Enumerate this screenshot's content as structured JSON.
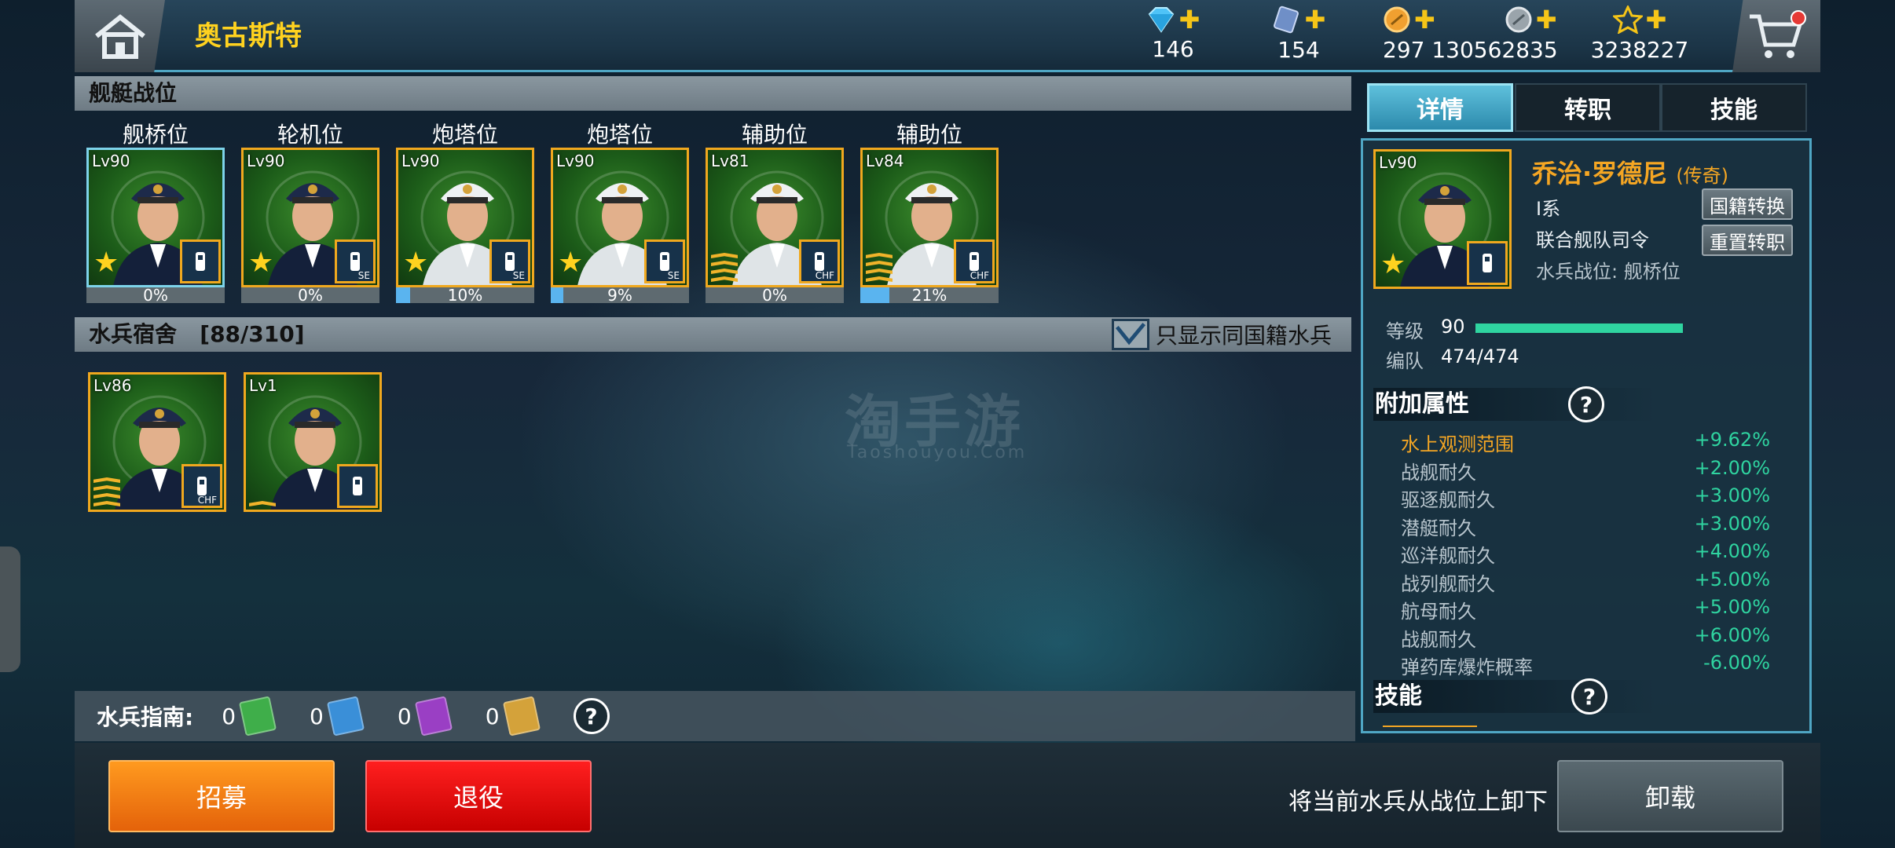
{
  "header": {
    "title": "奥古斯特",
    "resources": [
      {
        "icon": "diamond-icon",
        "value": "146"
      },
      {
        "icon": "blueprint-icon",
        "value": "154"
      },
      {
        "icon": "gold-coin-icon",
        "value": "297"
      },
      {
        "icon": "silver-coin-icon",
        "value": "130562835"
      },
      {
        "icon": "star-icon",
        "value": "3238227"
      }
    ]
  },
  "ship_positions": {
    "header": "舰艇战位",
    "slots": [
      {
        "label": "舰桥位",
        "level": "Lv90",
        "progress": 0,
        "progress_text": "0%",
        "rank": "star",
        "badge": "radio-icon",
        "badge_text": ""
      },
      {
        "label": "轮机位",
        "level": "Lv90",
        "progress": 0,
        "progress_text": "0%",
        "rank": "star",
        "badge": "engine-icon",
        "badge_text": "SE"
      },
      {
        "label": "炮塔位",
        "level": "Lv90",
        "progress": 10,
        "progress_text": "10%",
        "rank": "star",
        "badge": "hand-icon",
        "badge_text": "SE"
      },
      {
        "label": "炮塔位",
        "level": "Lv90",
        "progress": 9,
        "progress_text": "9%",
        "rank": "star",
        "badge": "hand-icon",
        "badge_text": "SE"
      },
      {
        "label": "辅助位",
        "level": "Lv81",
        "progress": 0,
        "progress_text": "0%",
        "rank": "chevrons",
        "badge": "radar-dish-icon",
        "badge_text": "CHF"
      },
      {
        "label": "辅助位",
        "level": "Lv84",
        "progress": 21,
        "progress_text": "21%",
        "rank": "chevrons",
        "badge": "radar-dish-icon",
        "badge_text": "CHF"
      }
    ]
  },
  "dormitory": {
    "header": "水兵宿舍",
    "count": "[88/310]",
    "filter_label": "只显示同国籍水兵",
    "sailors": [
      {
        "level": "Lv86",
        "rank": "chevrons",
        "badge": "radar-dish-icon",
        "badge_text": "CHF"
      },
      {
        "level": "Lv1",
        "rank": "single-chevron",
        "badge": "glove-icon",
        "badge_text": ""
      }
    ]
  },
  "guide": {
    "label": "水兵指南:",
    "items": [
      {
        "count": "0",
        "color": "#3fae4a"
      },
      {
        "count": "0",
        "color": "#3a8fd8"
      },
      {
        "count": "0",
        "color": "#9a3fc4"
      },
      {
        "count": "0",
        "color": "#d4a23a"
      }
    ],
    "help": "?"
  },
  "buttons": {
    "recruit": "招募",
    "retire": "退役",
    "unload_hint": "将当前水兵从战位上卸下",
    "unload": "卸载"
  },
  "tabs": [
    "详情",
    "转职",
    "技能"
  ],
  "detail": {
    "level": "Lv90",
    "name": "乔治·罗德尼",
    "rarity": "(传奇)",
    "nation": "I系",
    "role": "联合舰队司令",
    "position": "水兵战位: 舰桥位",
    "btn_nation": "国籍转换",
    "btn_reset": "重置转职",
    "level_label": "等级",
    "level_value": "90",
    "level_fill": 1.0,
    "team_label": "编队",
    "team_value": "474/474",
    "attr_header": "附加属性",
    "attributes": [
      {
        "name": "水上观测范围",
        "value": "+9.62%"
      },
      {
        "name": "战舰耐久",
        "value": "+2.00%"
      },
      {
        "name": "驱逐舰耐久",
        "value": "+3.00%"
      },
      {
        "name": "潜艇耐久",
        "value": "+3.00%"
      },
      {
        "name": "巡洋舰耐久",
        "value": "+4.00%"
      },
      {
        "name": "战列舰耐久",
        "value": "+5.00%"
      },
      {
        "name": "航母耐久",
        "value": "+5.00%"
      },
      {
        "name": "战舰耐久",
        "value": "+6.00%"
      },
      {
        "name": "弹药库爆炸概率",
        "value": "-6.00%"
      }
    ],
    "skill_header": "技能"
  },
  "watermark": {
    "main": "淘手游",
    "sub": "Taoshouyou.Com"
  },
  "colors": {
    "accent": "#4fa6c4",
    "gold": "#f5a623",
    "green": "#2fd4a0",
    "recruit": "#ff8a1a",
    "retire": "#e00000"
  }
}
